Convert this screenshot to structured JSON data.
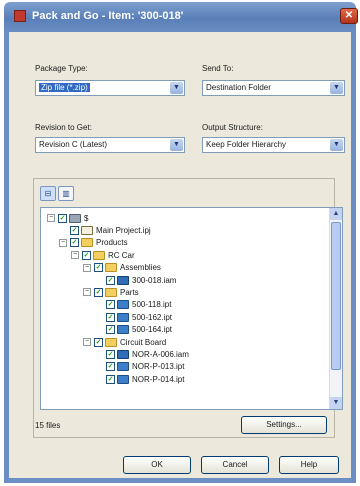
{
  "window": {
    "title": "Pack and Go - Item: '300-018'",
    "close_symbol": "✕"
  },
  "form": {
    "package_type_label": "Package Type:",
    "package_type_value": "Zip file (*.zip)",
    "send_to_label": "Send To:",
    "send_to_value": "Destination Folder",
    "revision_label": "Revision to Get:",
    "revision_value": "Revision C (Latest)",
    "output_label": "Output Structure:",
    "output_value": "Keep Folder Hierarchy"
  },
  "tree": {
    "items": [
      {
        "label": "$",
        "icon": "pc-icon",
        "expander": "−"
      },
      {
        "label": "Main Project.ipj",
        "icon": "proj-icon",
        "expander": ""
      },
      {
        "label": "Products",
        "icon": "folder-icon",
        "expander": "−"
      },
      {
        "label": "RC Car",
        "icon": "folder-icon",
        "expander": "−"
      },
      {
        "label": "Assemblies",
        "icon": "folder-icon",
        "expander": "−"
      },
      {
        "label": "300-018.iam",
        "icon": "asm-icon",
        "expander": ""
      },
      {
        "label": "Parts",
        "icon": "folder-icon",
        "expander": "−"
      },
      {
        "label": "500-118.ipt",
        "icon": "part-icon",
        "expander": ""
      },
      {
        "label": "500-162.ipt",
        "icon": "part-icon",
        "expander": ""
      },
      {
        "label": "500-164.ipt",
        "icon": "part-icon",
        "expander": ""
      },
      {
        "label": "Circuit Board",
        "icon": "folder-icon",
        "expander": "−"
      },
      {
        "label": "NOR-A-006.iam",
        "icon": "asm-icon",
        "expander": ""
      },
      {
        "label": "NOR-P-013.ipt",
        "icon": "part-icon",
        "expander": ""
      },
      {
        "label": "NOR-P-014.ipt",
        "icon": "part-icon",
        "expander": ""
      }
    ],
    "check_mark": "✓"
  },
  "footer": {
    "file_count": "15 files",
    "settings_label": "Settings...",
    "ok_label": "OK",
    "cancel_label": "Cancel",
    "help_label": "Help"
  },
  "colors": {
    "title_bar": "#5a7fb8",
    "selection": "#316ac5",
    "dialog_face": "#ece9dc"
  }
}
